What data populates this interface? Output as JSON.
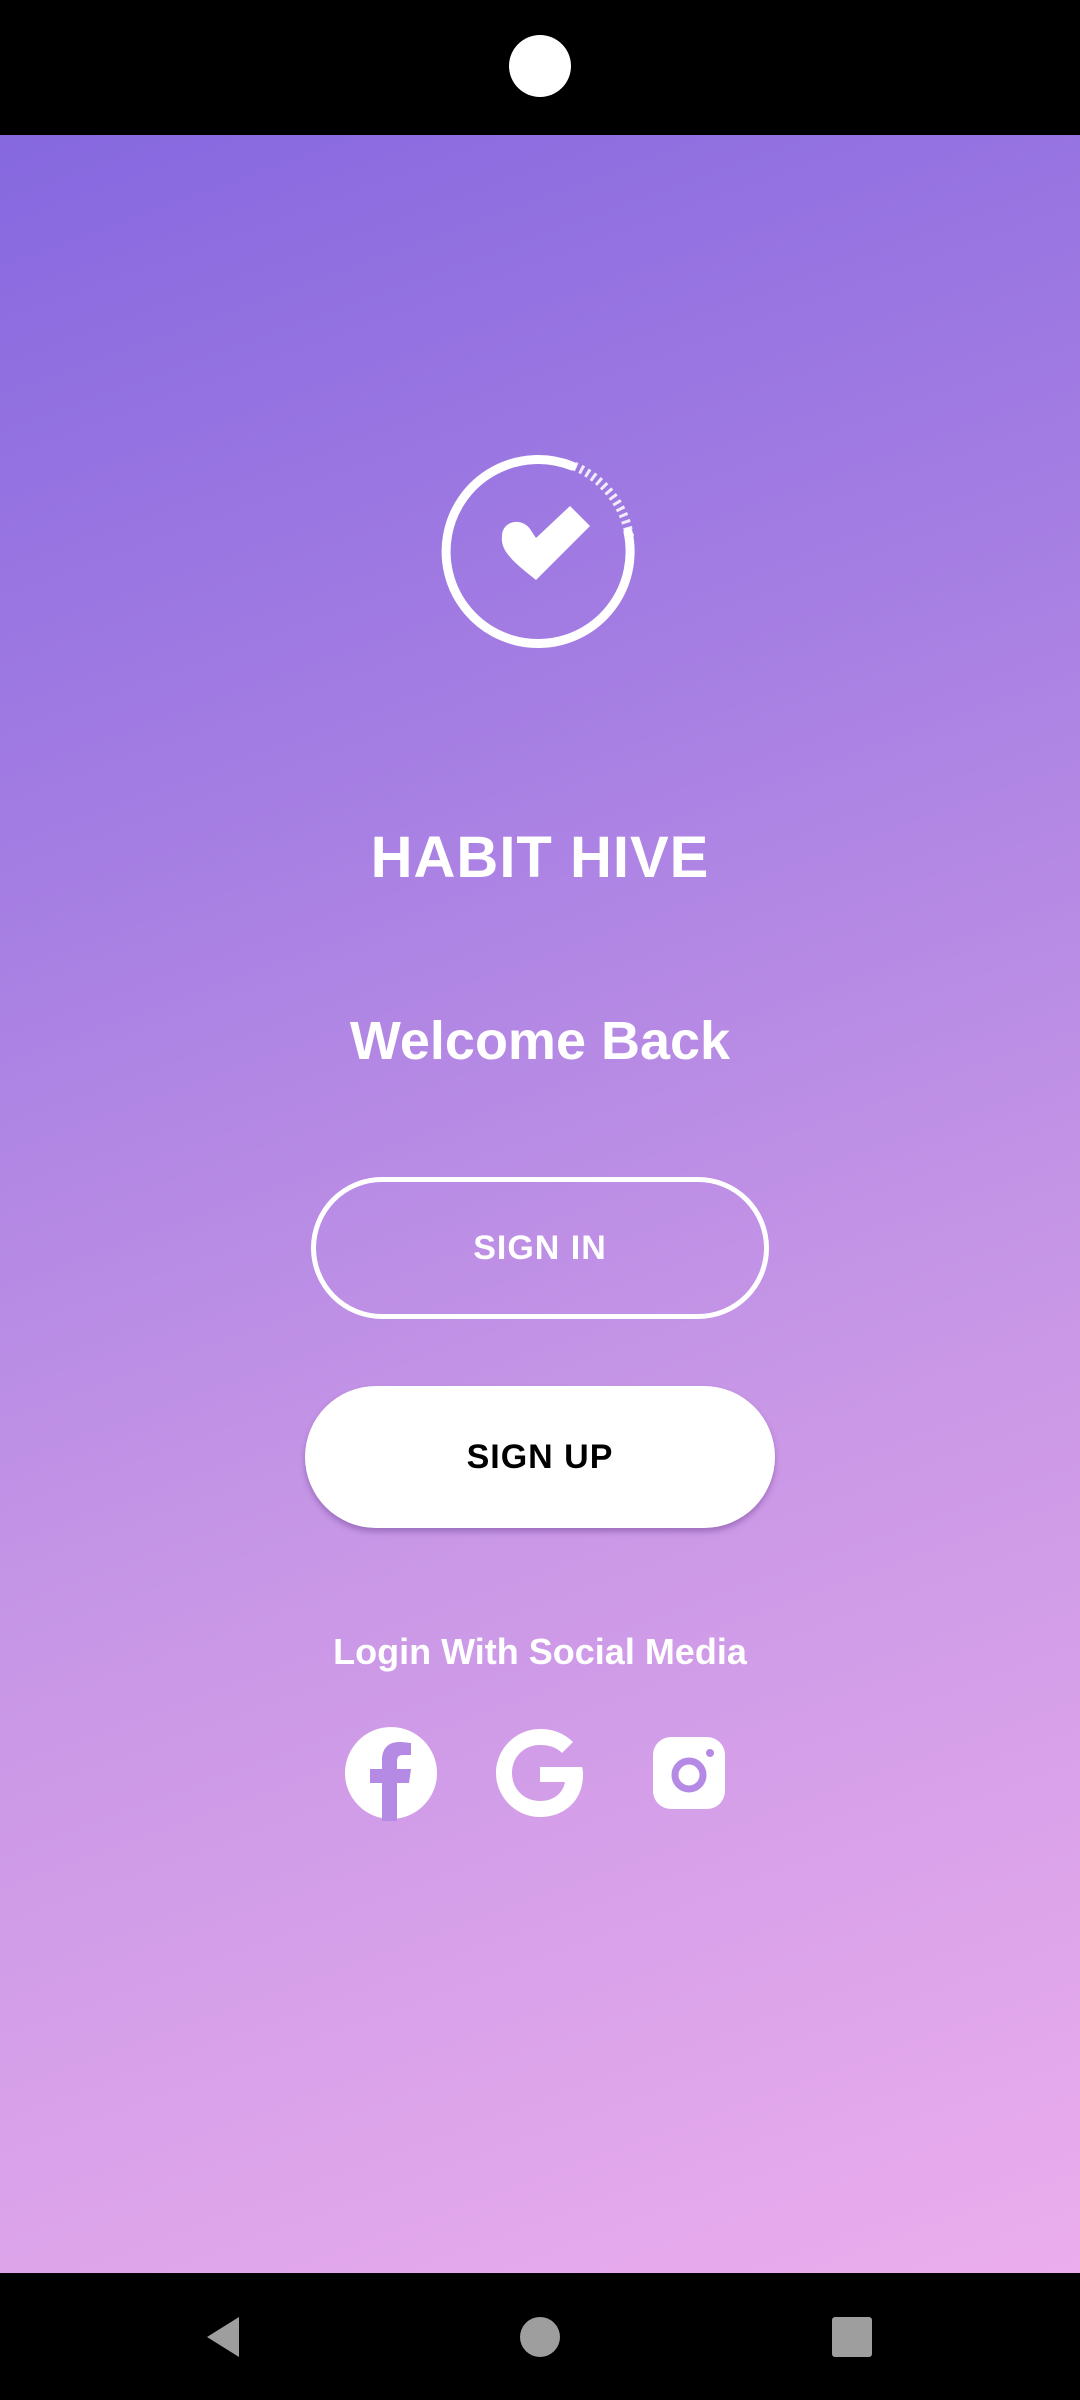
{
  "app": {
    "title": "HABIT HIVE",
    "welcome": "Welcome Back"
  },
  "buttons": {
    "sign_in": "SIGN IN",
    "sign_up": "SIGN UP"
  },
  "social": {
    "label": "Login With Social Media",
    "providers": [
      "facebook-icon",
      "google-icon",
      "instagram-icon"
    ]
  },
  "colors": {
    "gradient_start": "#8668df",
    "gradient_end": "#ebaded",
    "text": "#ffffff",
    "sign_up_text": "#000000"
  },
  "icons": {
    "logo": "check-heart-circle-icon",
    "nav_back": "back-triangle-icon",
    "nav_home": "home-circle-icon",
    "nav_recents": "recents-square-icon"
  }
}
